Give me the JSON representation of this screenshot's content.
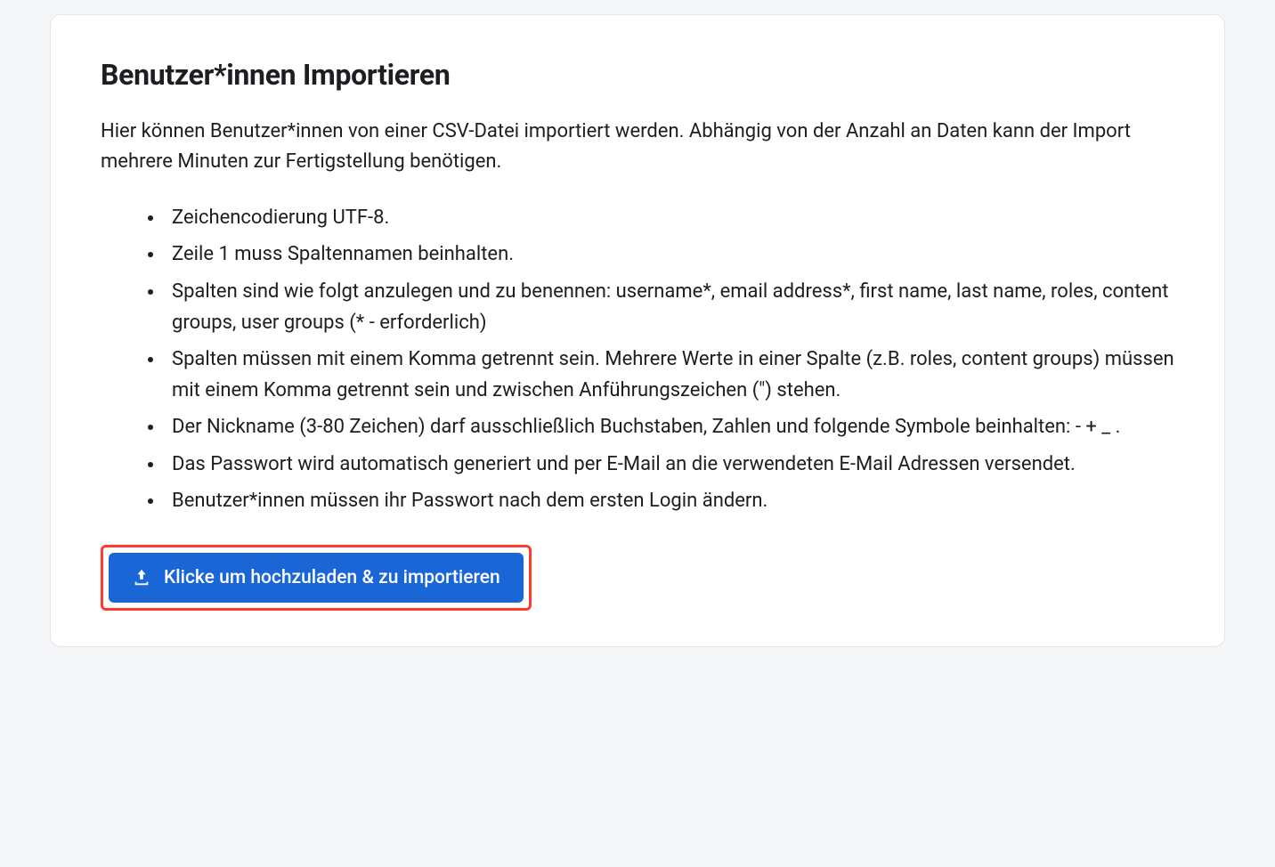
{
  "title": "Benutzer*innen Importieren",
  "intro": "Hier können Benutzer*innen von einer CSV-Datei importiert werden. Abhängig von der Anzahl an Daten kann der Import mehrere Minuten zur Fertigstellung benötigen.",
  "rules": [
    "Zeichencodierung UTF-8.",
    "Zeile 1 muss Spaltennamen beinhalten.",
    "Spalten sind wie folgt anzulegen und zu benennen: username*, email address*, first name, last name, roles, content groups, user groups (* - erforderlich)",
    "Spalten müssen mit einem Komma getrennt sein. Mehrere Werte in einer Spalte (z.B. roles, content groups) müssen mit einem Komma getrennt sein und zwischen Anführungszeichen (\") stehen.",
    "Der Nickname (3-80 Zeichen) darf ausschließlich Buchstaben, Zahlen und folgende Symbole beinhalten: - + _ .",
    "Das Passwort wird automatisch generiert und per E-Mail an die verwendeten E-Mail Adressen versendet.",
    "Benutzer*innen müssen ihr Passwort nach dem ersten Login ändern."
  ],
  "uploadButtonLabel": "Klicke um hochzuladen & zu importieren"
}
